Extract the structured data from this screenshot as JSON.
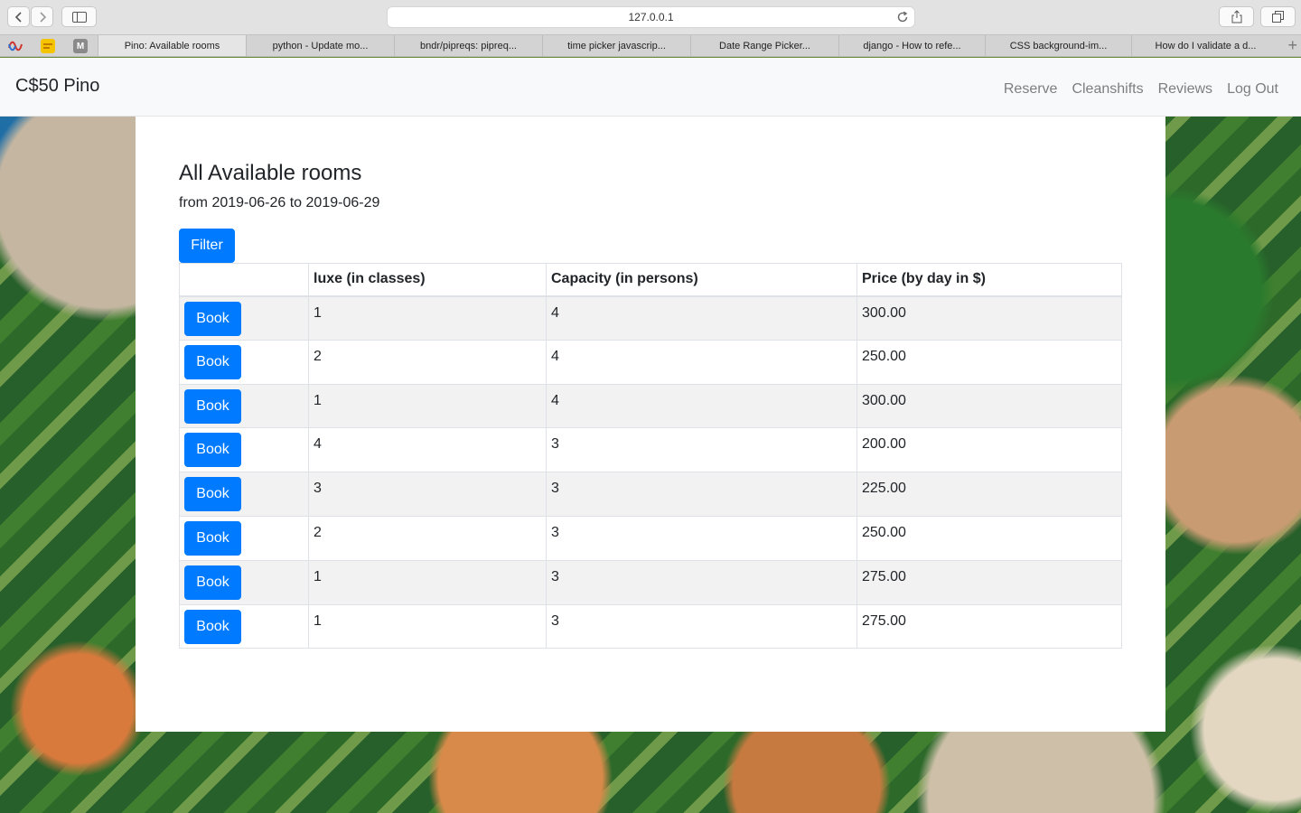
{
  "browser": {
    "url": "127.0.0.1",
    "tabs": [
      {
        "label": "Pino: Available rooms",
        "active": true
      },
      {
        "label": "python - Update mo...",
        "active": false
      },
      {
        "label": "bndr/pipreqs: pipreq...",
        "active": false
      },
      {
        "label": "time picker javascrip...",
        "active": false
      },
      {
        "label": "Date Range Picker...",
        "active": false
      },
      {
        "label": "django - How to refe...",
        "active": false
      },
      {
        "label": "CSS background-im...",
        "active": false
      },
      {
        "label": "How do I validate a d...",
        "active": false
      }
    ],
    "pinned_favicons": [
      "wave-favicon-icon",
      "sticky-note-favicon-icon",
      "m-favicon-icon"
    ],
    "pinned_m_letter": "M",
    "new_tab_label": "+"
  },
  "navbar": {
    "brand": "C$50 Pino",
    "links": [
      "Reserve",
      "Cleanshifts",
      "Reviews",
      "Log Out"
    ]
  },
  "main": {
    "title": "All Available rooms",
    "subtitle": "from 2019-06-26 to 2019-06-29",
    "filter_label": "Filter",
    "book_label": "Book",
    "columns": [
      "",
      "luxe (in classes)",
      "Capacity (in persons)",
      "Price (by day in $)"
    ],
    "rows": [
      [
        "1",
        "4",
        "300.00"
      ],
      [
        "2",
        "4",
        "250.00"
      ],
      [
        "1",
        "4",
        "300.00"
      ],
      [
        "4",
        "3",
        "200.00"
      ],
      [
        "3",
        "3",
        "225.00"
      ],
      [
        "2",
        "3",
        "250.00"
      ],
      [
        "1",
        "3",
        "275.00"
      ],
      [
        "1",
        "3",
        "275.00"
      ]
    ]
  },
  "colors": {
    "primary": "#007bff",
    "navbar_bg": "#f8f9fa",
    "stripe": "#f2f2f2"
  }
}
